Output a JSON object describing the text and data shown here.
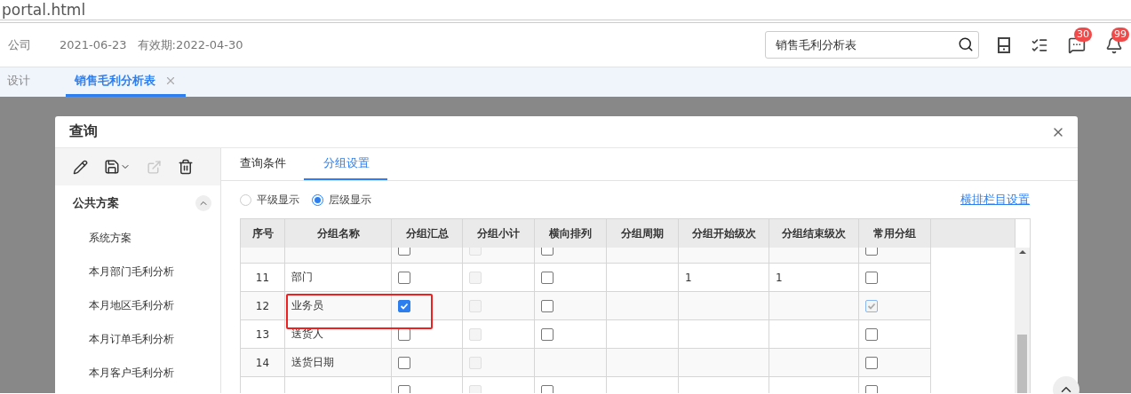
{
  "address_bar": {
    "url": "portal.html"
  },
  "header": {
    "company": "公司",
    "date": "2021-06-23",
    "validity": "有效期:2022-04-30",
    "search": {
      "value": "销售毛利分析表"
    },
    "icons": [
      {
        "kind": "form"
      },
      {
        "kind": "tasks"
      },
      {
        "kind": "message",
        "badge": "30"
      },
      {
        "kind": "bell",
        "badge": "99"
      }
    ]
  },
  "page_tabs": [
    {
      "label": "设计",
      "selected": false,
      "closable": false
    },
    {
      "label": "销售毛利分析表",
      "selected": true,
      "closable": true
    }
  ],
  "dialog": {
    "title": "查询",
    "toolbar": [
      {
        "kind": "edit",
        "disabled": false
      },
      {
        "kind": "save",
        "disabled": false
      },
      {
        "kind": "export",
        "disabled": true
      },
      {
        "kind": "delete",
        "disabled": false
      }
    ],
    "schemes": [
      {
        "label": "公共方案",
        "expanded": true,
        "children": [
          {
            "label": "系统方案"
          },
          {
            "label": "本月部门毛利分析"
          },
          {
            "label": "本月地区毛利分析"
          },
          {
            "label": "本月订单毛利分析"
          },
          {
            "label": "本月客户毛利分析"
          }
        ]
      }
    ],
    "tabs": [
      {
        "label": "查询条件",
        "selected": false
      },
      {
        "label": "分组设置",
        "selected": true
      }
    ],
    "display_modes": [
      {
        "label": "平级显示",
        "selected": false
      },
      {
        "label": "层级显示",
        "selected": true
      }
    ],
    "link": "横排栏目设置",
    "table": {
      "columns": [
        "序号",
        "分组名称",
        "分组汇总",
        "分组小计",
        "横向排列",
        "分组周期",
        "分组开始级次",
        "分组结束级次",
        "常用分组"
      ],
      "rows": [
        {
          "summary": {
            "checked": false
          },
          "subtotal": {
            "checked": false,
            "disabled": true
          },
          "horizontal": {
            "checked": false
          },
          "common": {
            "checked": false,
            "disabled": false
          }
        },
        {
          "no": "11",
          "name": "部门",
          "summary": {
            "checked": false
          },
          "subtotal": {
            "checked": false,
            "disabled": true
          },
          "horizontal": {
            "checked": false
          },
          "start": "1",
          "end": "1",
          "common": {
            "checked": false,
            "disabled": false
          }
        },
        {
          "no": "12",
          "name": "业务员",
          "summary": {
            "checked": true
          },
          "subtotal": {
            "checked": false,
            "disabled": true
          },
          "horizontal": {
            "checked": false
          },
          "common": {
            "checked": true,
            "disabled": true
          },
          "highlighted": true
        },
        {
          "no": "13",
          "name": "送货人",
          "summary": {
            "checked": false
          },
          "subtotal": {
            "checked": false,
            "disabled": true
          },
          "horizontal": {
            "checked": false
          },
          "common": {
            "checked": false,
            "disabled": false
          }
        },
        {
          "no": "14",
          "name": "送货日期",
          "summary": {
            "checked": false
          },
          "subtotal": {
            "checked": false,
            "disabled": true
          },
          "common": {
            "checked": false,
            "disabled": false
          }
        },
        {
          "summary": {
            "checked": false
          },
          "subtotal": {
            "checked": false,
            "disabled": true
          },
          "horizontal": {
            "checked": false
          },
          "common": {
            "checked": false,
            "disabled": false
          }
        }
      ]
    }
  }
}
